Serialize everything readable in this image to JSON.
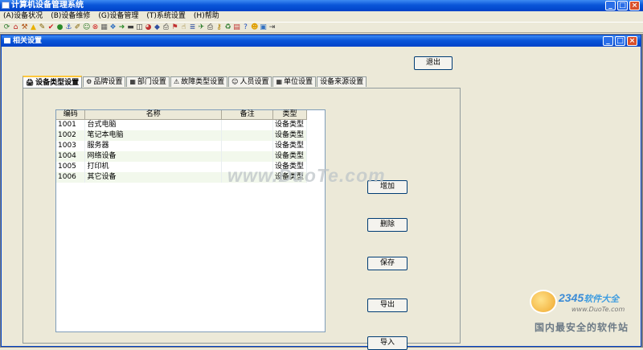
{
  "app": {
    "title": "计算机设备管理系统",
    "window_buttons": [
      "_",
      "□",
      "×"
    ]
  },
  "menu": [
    "(A)设备状况",
    "(B)设备维修",
    "(G)设备管理",
    "(T)系统设置",
    "(H)帮助"
  ],
  "toolbar_icons": [
    {
      "name": "refresh-icon",
      "glyph": "⟳",
      "color": "#2a7a2a"
    },
    {
      "name": "home-icon",
      "glyph": "⌂",
      "color": "#c02020"
    },
    {
      "name": "tool-icon",
      "glyph": "⚒",
      "color": "#b05010"
    },
    {
      "name": "warning-icon",
      "glyph": "▲",
      "color": "#e8b000"
    },
    {
      "name": "note-icon",
      "glyph": "✎",
      "color": "#806000"
    },
    {
      "name": "check-icon",
      "glyph": "✔",
      "color": "#d02020"
    },
    {
      "name": "ball-icon",
      "glyph": "●",
      "color": "#2a8a2a"
    },
    {
      "name": "anchor-icon",
      "glyph": "⚓",
      "color": "#2050c0"
    },
    {
      "name": "edit-icon",
      "glyph": "✐",
      "color": "#806000"
    },
    {
      "name": "people-icon",
      "glyph": "☺",
      "color": "#2a7a2a"
    },
    {
      "name": "stop-icon",
      "glyph": "⊗",
      "color": "#d02020"
    },
    {
      "name": "grid-icon",
      "glyph": "▦",
      "color": "#606060"
    },
    {
      "name": "windows-icon",
      "glyph": "❖",
      "color": "#3070c0"
    },
    {
      "name": "arrow-icon",
      "glyph": "➜",
      "color": "#2a8a2a"
    },
    {
      "name": "bar-icon",
      "glyph": "▬",
      "color": "#404040"
    },
    {
      "name": "panel-icon",
      "glyph": "◫",
      "color": "#404040"
    },
    {
      "name": "pie-icon",
      "glyph": "◕",
      "color": "#c03030"
    },
    {
      "name": "tag-icon",
      "glyph": "◆",
      "color": "#3050a0"
    },
    {
      "name": "print-icon",
      "glyph": "⎙",
      "color": "#404040"
    },
    {
      "name": "alarm-icon",
      "glyph": "⚑",
      "color": "#c03030"
    },
    {
      "name": "hand-icon",
      "glyph": "☝",
      "color": "#806000"
    },
    {
      "name": "list-icon",
      "glyph": "≣",
      "color": "#3050a0"
    },
    {
      "name": "bird-icon",
      "glyph": "✈",
      "color": "#2a7a2a"
    },
    {
      "name": "printer-icon",
      "glyph": "⎙",
      "color": "#303030"
    },
    {
      "name": "key-icon",
      "glyph": "⚷",
      "color": "#b08000"
    },
    {
      "name": "trash-icon",
      "glyph": "♻",
      "color": "#2a7a2a"
    },
    {
      "name": "chart-icon",
      "glyph": "▤",
      "color": "#c03030"
    },
    {
      "name": "help-icon",
      "glyph": "?",
      "color": "#2050c0"
    },
    {
      "name": "smile-icon",
      "glyph": "☻",
      "color": "#e0a000"
    },
    {
      "name": "card-icon",
      "glyph": "▣",
      "color": "#3070c0"
    },
    {
      "name": "exit-icon",
      "glyph": "⇥",
      "color": "#404040"
    }
  ],
  "child": {
    "title": "相关设置",
    "window_buttons": [
      "_",
      "□",
      "×"
    ],
    "exit_label": "退出"
  },
  "tabs": [
    {
      "label": "设备类型设置",
      "icon": "🖨",
      "active": true
    },
    {
      "label": "品牌设置",
      "icon": "⚙",
      "active": false
    },
    {
      "label": "部门设置",
      "icon": "▦",
      "active": false
    },
    {
      "label": "故障类型设置",
      "icon": "⚠",
      "active": false
    },
    {
      "label": "人员设置",
      "icon": "☺",
      "active": false
    },
    {
      "label": "单位设置",
      "icon": "▦",
      "active": false
    },
    {
      "label": "设备来源设置",
      "icon": "",
      "active": false
    }
  ],
  "grid": {
    "columns": [
      "编码",
      "名称",
      "备注",
      "类型"
    ],
    "rows": [
      [
        "1001",
        "台式电脑",
        "",
        "设备类型"
      ],
      [
        "1002",
        "笔记本电脑",
        "",
        "设备类型"
      ],
      [
        "1003",
        "服务器",
        "",
        "设备类型"
      ],
      [
        "1004",
        "网络设备",
        "",
        "设备类型"
      ],
      [
        "1005",
        "打印机",
        "",
        "设备类型"
      ],
      [
        "1006",
        "其它设备",
        "",
        "设备类型"
      ]
    ]
  },
  "actions": {
    "add": "增加",
    "delete": "删除",
    "save": "保存",
    "export": "导出",
    "import": "导入"
  },
  "watermark": {
    "center": "www.DuoTe.com",
    "brand_num": "2345",
    "brand_cn": "软件大全",
    "url": "www.DuoTe.com",
    "slogan": "国内最安全的软件站"
  }
}
